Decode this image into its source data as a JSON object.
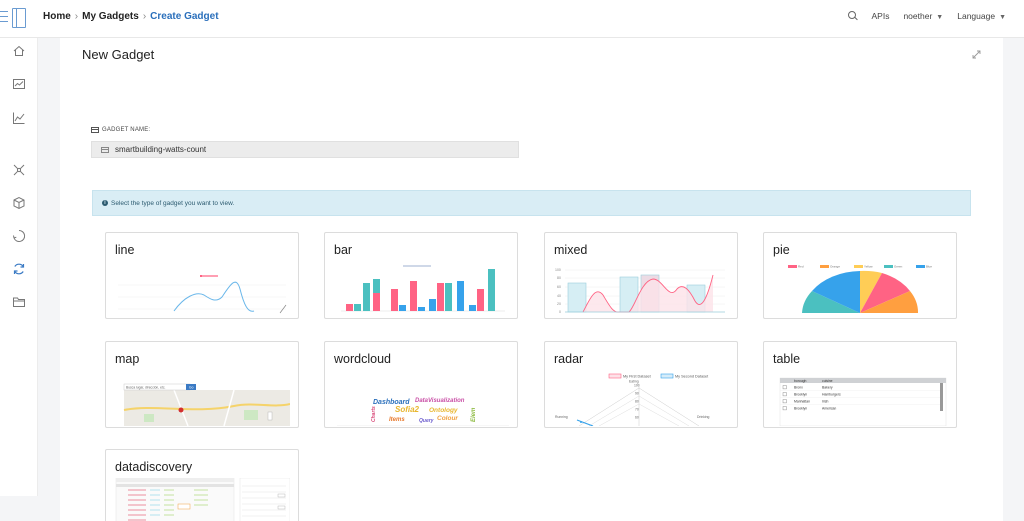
{
  "breadcrumb": {
    "home": "Home",
    "my_gadgets": "My Gadgets",
    "current": "Create Gadget"
  },
  "topbar": {
    "apis": "APIs",
    "user": "noether",
    "language": "Language"
  },
  "sidebar": {
    "items": [
      {
        "icon": "home-icon"
      },
      {
        "icon": "dashboard-icon"
      },
      {
        "icon": "chart-icon"
      },
      {
        "icon": "network-icon"
      },
      {
        "icon": "cube-icon"
      },
      {
        "icon": "shield-icon"
      },
      {
        "icon": "refresh-icon"
      },
      {
        "icon": "folder-icon"
      }
    ]
  },
  "panel": {
    "title": "New Gadget",
    "gadget_name_label": "GADGET NAME:",
    "gadget_name_value": "smartbuilding-watts-count",
    "info_text": "Select the type of gadget you want to view."
  },
  "gadgets": [
    {
      "label": "line"
    },
    {
      "label": "bar"
    },
    {
      "label": "mixed"
    },
    {
      "label": "pie"
    },
    {
      "label": "map"
    },
    {
      "label": "wordcloud"
    },
    {
      "label": "radar"
    },
    {
      "label": "table"
    },
    {
      "label": "datadiscovery"
    }
  ],
  "previews": {
    "map_search": "Busca lugar, dirección, etc.",
    "map_button": "Go",
    "wordcloud_words": [
      "Dashboard",
      "DataVisualization",
      "Sofia2",
      "Ontology",
      "Colour",
      "Items",
      "Elem",
      "Query",
      "Charts"
    ],
    "radar_legend": [
      "My First Dataset",
      "My Second Dataset"
    ],
    "radar_ticks": [
      "100",
      "90",
      "80",
      "70",
      "60"
    ],
    "radar_axes": [
      "Eating",
      "Running",
      "Drinking"
    ],
    "table_headers": [
      "borough",
      "cuisine"
    ],
    "table_rows": [
      [
        "Bronx",
        "Bakery"
      ],
      [
        "Brooklyn",
        "Hamburgers"
      ],
      [
        "Manhattan",
        "Irish"
      ],
      [
        "Brooklyn",
        "American"
      ]
    ],
    "pie_legend": [
      "Red",
      "Orange",
      "Yellow",
      "Green",
      "Blue"
    ]
  },
  "colors": {
    "accent": "#2a6fbb",
    "pink": "#ff6384",
    "teal": "#4bc0c0",
    "blue": "#36a2eb",
    "orange": "#ff9f40",
    "yellow": "#ffcd56",
    "info_bg": "#d9edf5"
  }
}
